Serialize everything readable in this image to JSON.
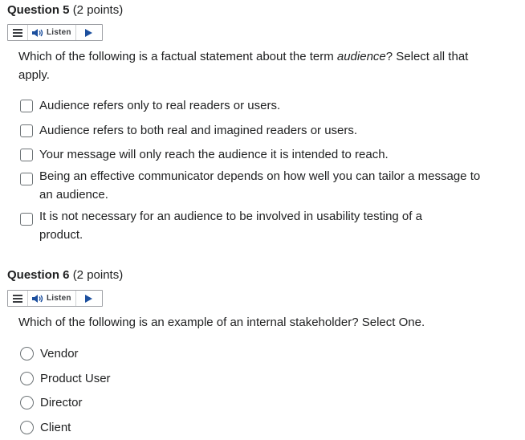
{
  "questions": [
    {
      "number": "Question 5",
      "points": "(2 points)",
      "listen_label": "Listen",
      "prompt_before": "Which of the following is a factual statement about the term ",
      "prompt_emph": "audience",
      "prompt_after": "? Select all that apply.",
      "options": [
        "Audience refers only to real readers or users.",
        "Audience refers to both real and imagined readers or users.",
        "Your message will only reach the audience it is intended to reach.",
        "Being an effective communicator depends on how well you can tailor a message to an audience.",
        "It is not necessary for an audience to be involved in usability testing of a product."
      ]
    },
    {
      "number": "Question 6",
      "points": "(2 points)",
      "listen_label": "Listen",
      "prompt": "Which of the following is an example of an internal stakeholder? Select One.",
      "options": [
        "Vendor",
        "Product User",
        "Director",
        "Client"
      ]
    }
  ],
  "icons": {
    "menu": "menu-icon",
    "speaker": "speaker-icon",
    "play": "play-icon"
  },
  "colors": {
    "text": "#202122",
    "border": "#6e7477",
    "speaker_blue": "#1c4f9e"
  }
}
